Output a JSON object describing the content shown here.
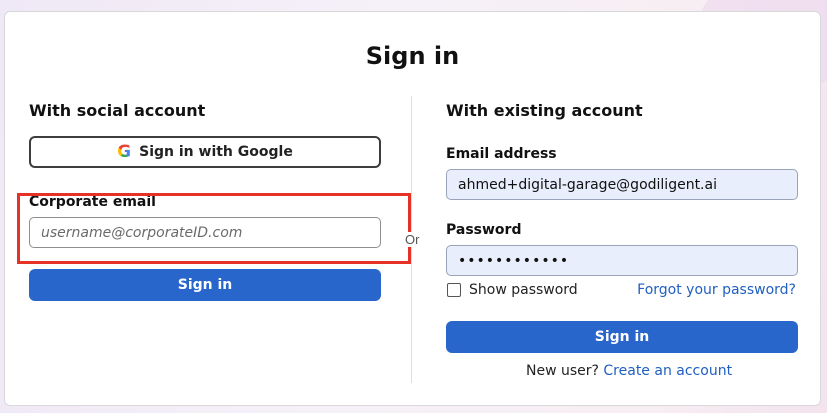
{
  "title": "Sign in",
  "social": {
    "heading": "With social account",
    "google_label": "Sign in with Google",
    "google_icon": "G",
    "corporate_label": "Corporate email",
    "corporate_placeholder": "username@corporateID.com",
    "signin_label": "Sign in"
  },
  "separator": "Or",
  "existing": {
    "heading": "With existing account",
    "email_label": "Email address",
    "email_value": "ahmed+digital-garage@godiligent.ai",
    "password_label": "Password",
    "password_value": "••••••••••••",
    "show_password_label": "Show password",
    "forgot_label": "Forgot your password?",
    "signin_label": "Sign in",
    "new_user_text": "New user?",
    "create_account_label": "Create an account"
  },
  "colors": {
    "primary": "#2966cc",
    "highlight": "#e63127",
    "filled_input": "#e8eefb"
  }
}
